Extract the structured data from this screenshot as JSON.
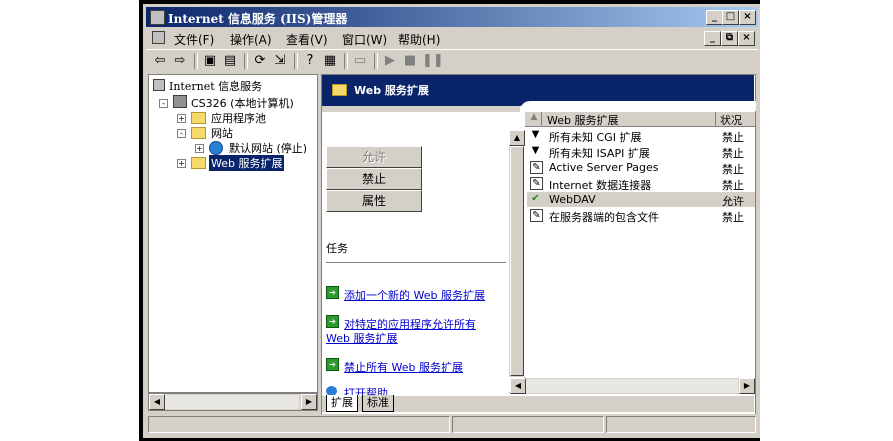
{
  "window": {
    "title": "Internet 信息服务 (IIS)管理器",
    "controls": {
      "minimize": "_",
      "maximize": "□",
      "close": "×"
    }
  },
  "menubar": {
    "items": [
      "文件(F)",
      "操作(A)",
      "查看(V)",
      "窗口(W)",
      "帮助(H)"
    ],
    "mdi_controls": {
      "minimize": "_",
      "restore": "⧉",
      "close": "×"
    }
  },
  "tree": {
    "root": "Internet 信息服务",
    "computer": "CS326 (本地计算机)",
    "app_pools": "应用程序池",
    "websites": "网站",
    "default_site": "默认网站 (停止)",
    "web_ext": "Web 服务扩展",
    "expander_plus": "+",
    "expander_minus": "-"
  },
  "header": {
    "title": "Web 服务扩展"
  },
  "actions": {
    "allow": "允许",
    "prohibit": "禁止",
    "properties": "属性"
  },
  "tasks": {
    "heading": "任务",
    "items": [
      "添加一个新的 Web 服务扩展",
      "对特定的应用程序允许所有",
      "Web 服务扩展",
      "禁止所有 Web 服务扩展",
      "打开帮助"
    ]
  },
  "list": {
    "col_name": "Web 服务扩展",
    "col_status": "状况",
    "rows": [
      {
        "name": "所有未知 CGI 扩展",
        "status": "禁止",
        "icon": "filter-icon"
      },
      {
        "name": "所有未知 ISAPI 扩展",
        "status": "禁止",
        "icon": "filter-icon"
      },
      {
        "name": "Active Server Pages",
        "status": "禁止",
        "icon": "document-icon"
      },
      {
        "name": "Internet 数据连接器",
        "status": "禁止",
        "icon": "document-icon"
      },
      {
        "name": "WebDAV",
        "status": "允许",
        "icon": "allowed-check-icon"
      },
      {
        "name": "在服务器端的包含文件",
        "status": "禁止",
        "icon": "document-icon"
      }
    ]
  },
  "tabs": [
    "扩展",
    "标准"
  ],
  "colors": {
    "accent": "#0a246a",
    "face": "#d4d0c8",
    "link": "#0000cc",
    "selection": "#0a246a"
  }
}
